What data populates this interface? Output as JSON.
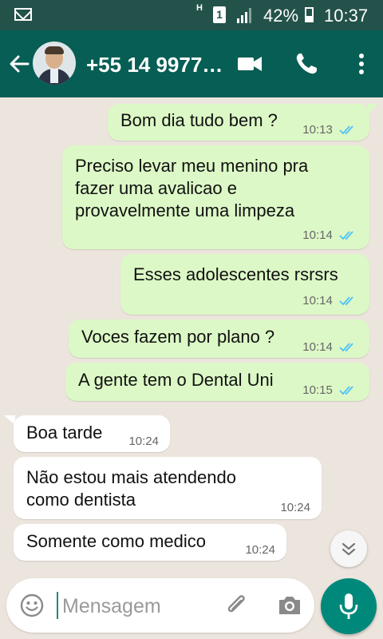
{
  "status_bar": {
    "network_label": "H",
    "sim_label": "1",
    "battery_pct": "42%",
    "time": "10:37",
    "icons": [
      "mail-icon",
      "sim-icon",
      "signal-icon",
      "battery-icon"
    ]
  },
  "header": {
    "title": "+55 14 9977…",
    "icons": [
      "back-arrow-icon",
      "avatar",
      "video-call-icon",
      "phone-icon",
      "more-options-icon"
    ]
  },
  "messages": [
    {
      "dir": "out",
      "text": "Bom dia tudo bem ?",
      "time": "10:13",
      "read": true
    },
    {
      "dir": "out",
      "text": "Preciso levar meu menino pra\nfazer uma avalicao e\nprovavelmente uma limpeza",
      "time": "10:14",
      "read": true
    },
    {
      "dir": "out",
      "text": "Esses adolescentes rsrsrs",
      "time": "10:14",
      "read": true
    },
    {
      "dir": "out",
      "text": "Voces fazem por plano ?",
      "time": "10:14",
      "read": true
    },
    {
      "dir": "out",
      "text": "A gente tem o Dental Uni",
      "time": "10:15",
      "read": true
    },
    {
      "dir": "in",
      "text": "Boa tarde",
      "time": "10:24"
    },
    {
      "dir": "in",
      "text": "Não estou mais atendendo\ncomo dentista",
      "time": "10:24"
    },
    {
      "dir": "in",
      "text": "Somente como medico",
      "time": "10:24"
    }
  ],
  "input": {
    "placeholder": "Mensagem",
    "icons": [
      "emoji-icon",
      "attach-icon",
      "camera-icon",
      "mic-icon"
    ]
  },
  "colors": {
    "status_bar": "#23524a",
    "header": "#075e54",
    "outgoing_bubble": "#dcf8c6",
    "incoming_bubble": "#ffffff",
    "chat_bg": "#ece5dd",
    "read_ticks": "#4fc3f7",
    "mic_button": "#00897b"
  }
}
